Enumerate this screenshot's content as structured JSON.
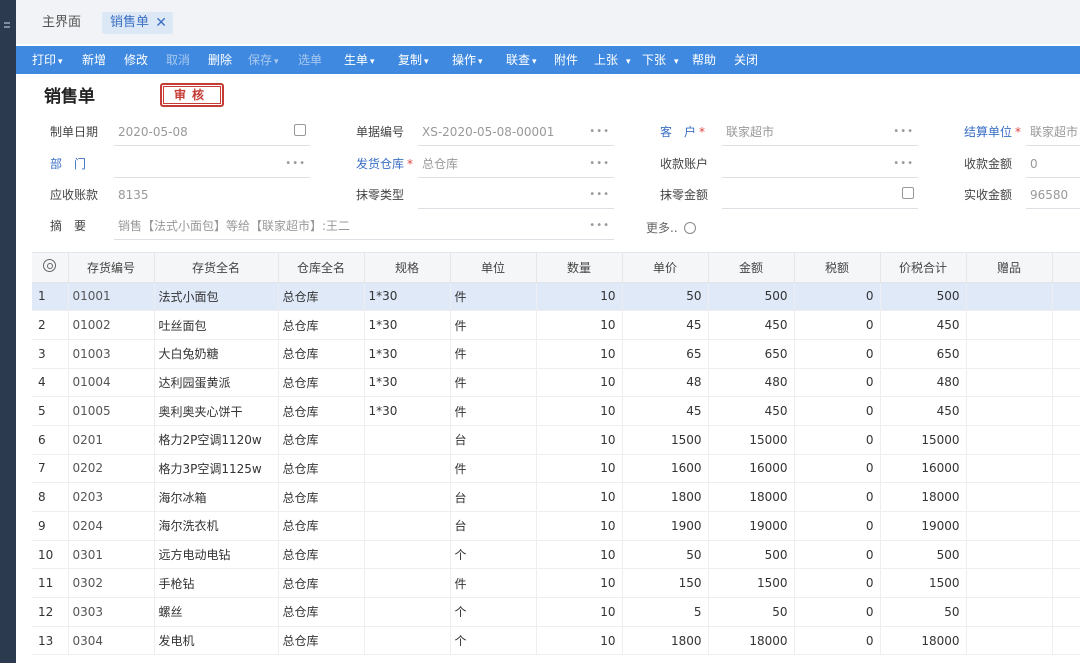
{
  "tabs": {
    "home": "主界面",
    "active": "销售单"
  },
  "toolbar": {
    "print": "打印",
    "new": "新增",
    "edit": "修改",
    "cancel": "取消",
    "delete": "删除",
    "save": "保存",
    "select": "选单",
    "gen": "生单",
    "copy": "复制",
    "operate": "操作",
    "link": "联查",
    "attach": "附件",
    "prev": "上张",
    "next": "下张",
    "help": "帮助",
    "close": "关闭"
  },
  "doc": {
    "title": "销售单",
    "stamp": "审核"
  },
  "form": {
    "date_label": "制单日期",
    "date_value": "2020-05-08",
    "billno_label": "单据编号",
    "billno_value": "XS-2020-05-08-00001",
    "customer_label": "客　户",
    "customer_value": "联家超市",
    "settle_label": "结算单位",
    "settle_value": "联家超市",
    "dept_label": "部　门",
    "dept_value": "",
    "warehouse_label": "发货仓库",
    "warehouse_value": "总仓库",
    "account_label": "收款账户",
    "account_value": "",
    "recv_amount_label": "收款金额",
    "recv_amount_value": "0",
    "receivable_label": "应收账款",
    "receivable_value": "8135",
    "round_type_label": "抹零类型",
    "round_type_value": "",
    "round_amount_label": "抹零金额",
    "round_amount_value": "",
    "actual_label": "实收金额",
    "actual_value": "96580",
    "memo_label": "摘　要",
    "memo_value": "销售【法式小面包】等给【联家超市】:王二",
    "more": "更多.."
  },
  "table": {
    "headers": [
      "存货编号",
      "存货全名",
      "仓库全名",
      "规格",
      "单位",
      "数量",
      "单价",
      "金额",
      "税额",
      "价税合计",
      "赠品"
    ],
    "rows": [
      [
        "1",
        "01001",
        "法式小面包",
        "总仓库",
        "1*30",
        "件",
        "10",
        "50",
        "500",
        "0",
        "500"
      ],
      [
        "2",
        "01002",
        "吐丝面包",
        "总仓库",
        "1*30",
        "件",
        "10",
        "45",
        "450",
        "0",
        "450"
      ],
      [
        "3",
        "01003",
        "大白兔奶糖",
        "总仓库",
        "1*30",
        "件",
        "10",
        "65",
        "650",
        "0",
        "650"
      ],
      [
        "4",
        "01004",
        "达利园蛋黄派",
        "总仓库",
        "1*30",
        "件",
        "10",
        "48",
        "480",
        "0",
        "480"
      ],
      [
        "5",
        "01005",
        "奥利奥夹心饼干",
        "总仓库",
        "1*30",
        "件",
        "10",
        "45",
        "450",
        "0",
        "450"
      ],
      [
        "6",
        "0201",
        "格力2P空调1120w",
        "总仓库",
        "",
        "台",
        "10",
        "1500",
        "15000",
        "0",
        "15000"
      ],
      [
        "7",
        "0202",
        "格力3P空调1125w",
        "总仓库",
        "",
        "件",
        "10",
        "1600",
        "16000",
        "0",
        "16000"
      ],
      [
        "8",
        "0203",
        "海尔冰箱",
        "总仓库",
        "",
        "台",
        "10",
        "1800",
        "18000",
        "0",
        "18000"
      ],
      [
        "9",
        "0204",
        "海尔洗衣机",
        "总仓库",
        "",
        "台",
        "10",
        "1900",
        "19000",
        "0",
        "19000"
      ],
      [
        "10",
        "0301",
        "远方电动电钻",
        "总仓库",
        "",
        "个",
        "10",
        "50",
        "500",
        "0",
        "500"
      ],
      [
        "11",
        "0302",
        "手枪钻",
        "总仓库",
        "",
        "件",
        "10",
        "150",
        "1500",
        "0",
        "1500"
      ],
      [
        "12",
        "0303",
        "螺丝",
        "总仓库",
        "",
        "个",
        "10",
        "5",
        "50",
        "0",
        "50"
      ],
      [
        "13",
        "0304",
        "发电机",
        "总仓库",
        "",
        "个",
        "10",
        "1800",
        "18000",
        "0",
        "18000"
      ]
    ]
  }
}
